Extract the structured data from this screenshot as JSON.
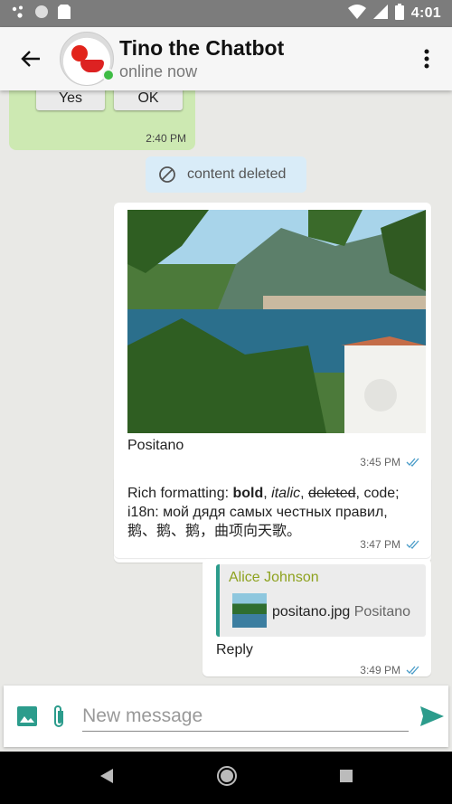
{
  "status_bar": {
    "time": "4:01"
  },
  "header": {
    "title": "Tino the Chatbot",
    "subtitle": "online now"
  },
  "messages": {
    "incoming_buttons": [
      "Yes",
      "OK"
    ],
    "incoming_time": "2:40 PM",
    "deleted_text": "content deleted",
    "photo_caption": "Positano",
    "photo_time": "3:45 PM",
    "rich": {
      "prefix": "Rich formatting: ",
      "bold": "bold",
      "sep1": ", ",
      "italic": "italic",
      "sep2": ", ",
      "deleted": "deleted",
      "suffix": ", code;",
      "line2": "i18n: мой дядя самых честных правил,",
      "line3": "鹅、鹅、鹅，曲项向天歌。"
    },
    "rich_time": "3:47 PM",
    "reply_quote": {
      "author": "Alice Johnson",
      "filename": "positano.jpg",
      "file_caption": "Positano"
    },
    "reply_text": "Reply",
    "reply_time": "3:49 PM"
  },
  "composer": {
    "placeholder": "New message"
  },
  "colors": {
    "accent": "#2c9c8c",
    "incoming_bubble": "#cde9b2",
    "deleted_bubble": "#d9ecf8",
    "online": "#3fbc45"
  }
}
